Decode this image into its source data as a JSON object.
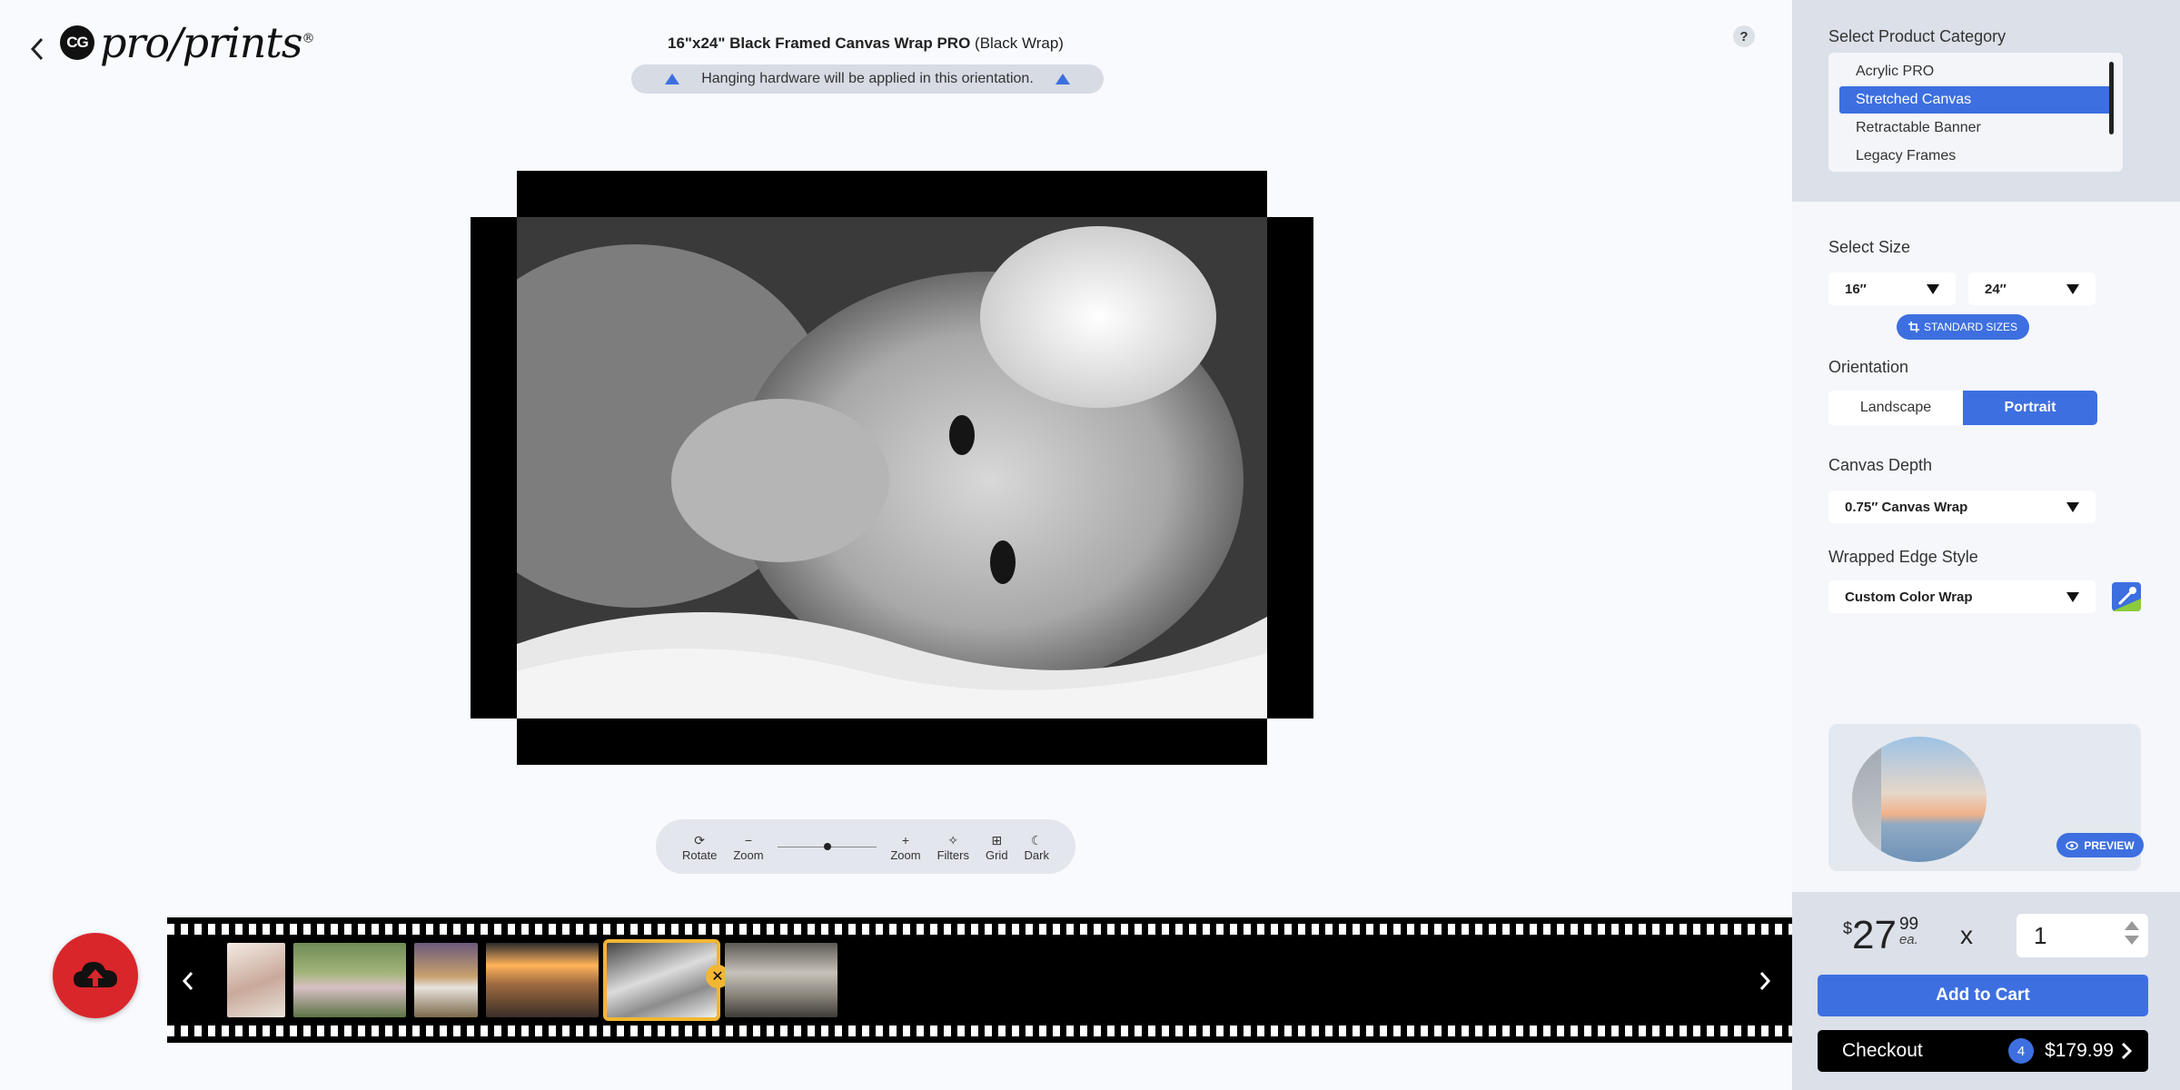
{
  "header": {
    "logo_badge": "CG",
    "logo_text": "pro/prints",
    "logo_mark": "®",
    "product_title_bold": "16\"x24\" Black Framed Canvas Wrap PRO",
    "product_title_rest": " (Black Wrap)",
    "hanging_notice": "Hanging hardware will be applied in this orientation.",
    "help_label": "?"
  },
  "toolbar": {
    "rotate": "Rotate",
    "zoom_out": "Zoom",
    "zoom_in": "Zoom",
    "filters": "Filters",
    "grid": "Grid",
    "dark": "Dark",
    "zoom_level": 0.5
  },
  "filmstrip": {
    "thumbnails": [
      {
        "name": "girl-portrait",
        "selected": false
      },
      {
        "name": "girl-in-meadow",
        "selected": false
      },
      {
        "name": "woman-in-field",
        "selected": false
      },
      {
        "name": "couple-sunset",
        "selected": false
      },
      {
        "name": "newborn-bw",
        "selected": true
      },
      {
        "name": "wedding-couple",
        "selected": false
      }
    ],
    "remove_label": "✕"
  },
  "sidebar": {
    "category_label": "Select Product Category",
    "categories": [
      "Acrylic PRO",
      "Stretched Canvas",
      "Retractable Banner",
      "Legacy Frames"
    ],
    "active_category": "Stretched Canvas",
    "size_label": "Select Size",
    "size_width": "16″",
    "size_height": "24″",
    "standard_sizes": "STANDARD SIZES",
    "orientation_label": "Orientation",
    "orientation_landscape": "Landscape",
    "orientation_portrait": "Portrait",
    "active_orientation": "Portrait",
    "depth_label": "Canvas Depth",
    "depth_value": "0.75″ Canvas Wrap",
    "edge_label": "Wrapped Edge Style",
    "edge_value": "Custom Color Wrap",
    "preview_label": "PREVIEW"
  },
  "cart": {
    "currency": "$",
    "price_dollars": "27",
    "price_cents": "99",
    "price_unit": "ea.",
    "times": "x",
    "quantity": "1",
    "add_to_cart": "Add to Cart",
    "checkout": "Checkout",
    "cart_count": "4",
    "cart_total": "$179.99"
  },
  "colors": {
    "accent": "#3d6fe0",
    "upload": "#d9262b",
    "selected_thumb": "#f2b632"
  }
}
